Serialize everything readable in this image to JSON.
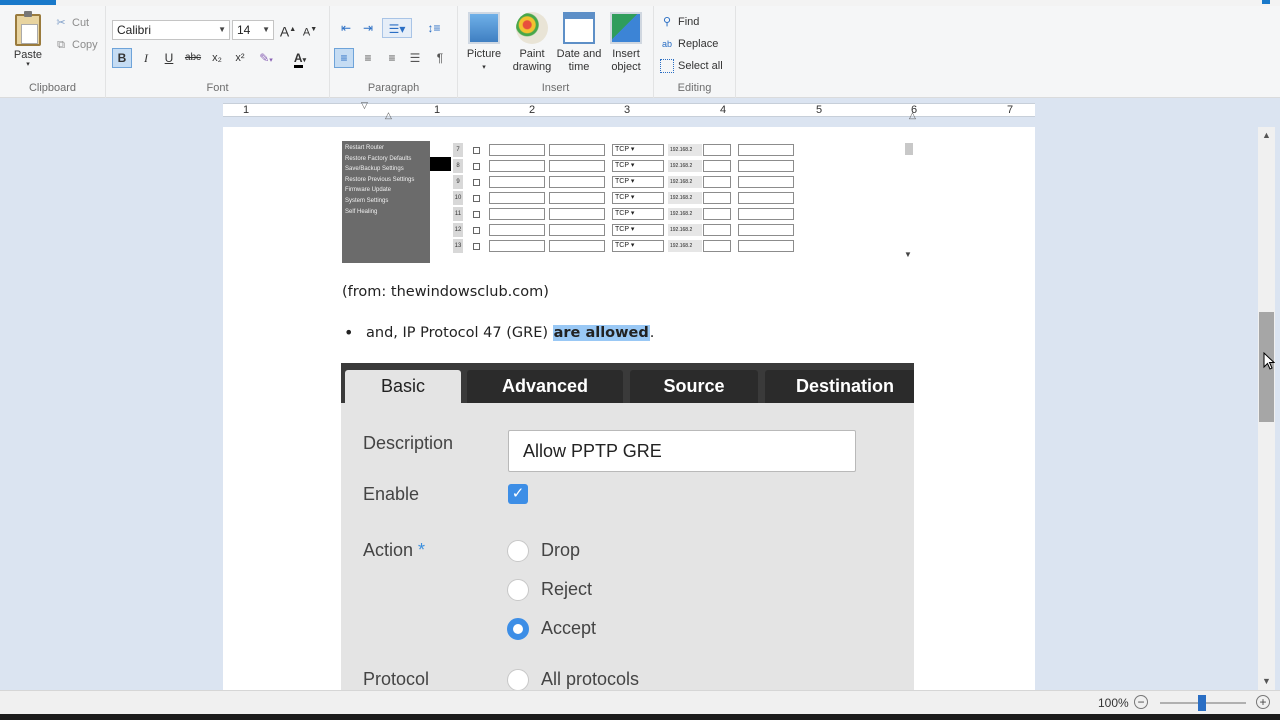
{
  "ribbon": {
    "clipboard": {
      "label": "Clipboard",
      "paste": "Paste",
      "cut": "Cut",
      "copy": "Copy"
    },
    "font": {
      "label": "Font",
      "family": "Calibri",
      "size": "14",
      "bold": "B",
      "italic": "I",
      "underline": "U",
      "strike": "abc",
      "subscript": "x₂",
      "superscript": "x²"
    },
    "paragraph": {
      "label": "Paragraph"
    },
    "insert": {
      "label": "Insert",
      "picture": "Picture",
      "paint_drawing": "Paint drawing",
      "date_time": "Date and time",
      "insert_object": "Insert object"
    },
    "editing": {
      "label": "Editing",
      "find": "Find",
      "replace": "Replace",
      "select_all": "Select all"
    }
  },
  "ruler": {
    "numbers": [
      "1",
      "1",
      "2",
      "3",
      "4",
      "5",
      "6",
      "7"
    ]
  },
  "router_image": {
    "menu": [
      "Restart Router",
      "Restore Factory Defaults",
      "Save/Backup Settings",
      "Restore Previous Settings",
      "Firmware Update",
      "System Settings",
      "Self Healing"
    ],
    "rows": [
      {
        "num": "7",
        "proto": "TCP",
        "ip": "192.168.2"
      },
      {
        "num": "8",
        "proto": "TCP",
        "ip": "192.168.2"
      },
      {
        "num": "9",
        "proto": "TCP",
        "ip": "192.168.2"
      },
      {
        "num": "10",
        "proto": "TCP",
        "ip": "192.168.2"
      },
      {
        "num": "11",
        "proto": "TCP",
        "ip": "192.168.2"
      },
      {
        "num": "12",
        "proto": "TCP",
        "ip": "192.168.2"
      },
      {
        "num": "13",
        "proto": "TCP",
        "ip": "192.168.2"
      }
    ]
  },
  "document": {
    "caption": "(from: thewindowsclub.com)",
    "bullet_prefix": "and, IP Protocol 47 (GRE) ",
    "bullet_highlight": "are allowed",
    "bullet_suffix": "."
  },
  "firewall_image": {
    "tabs": [
      "Basic",
      "Advanced",
      "Source",
      "Destination"
    ],
    "description_label": "Description",
    "description_value": "Allow PPTP GRE",
    "enable_label": "Enable",
    "action_label": "Action",
    "action_required": "*",
    "actions": [
      "Drop",
      "Reject",
      "Accept"
    ],
    "selected_action": "Accept",
    "protocol_label": "Protocol",
    "protocol_option": "All protocols"
  },
  "status": {
    "zoom": "100%",
    "zoom_minus": "−",
    "zoom_plus": "+"
  },
  "colors": {
    "accent": "#1979ca",
    "highlight": "#99c8f5",
    "checkbox": "#3d8ee6"
  }
}
